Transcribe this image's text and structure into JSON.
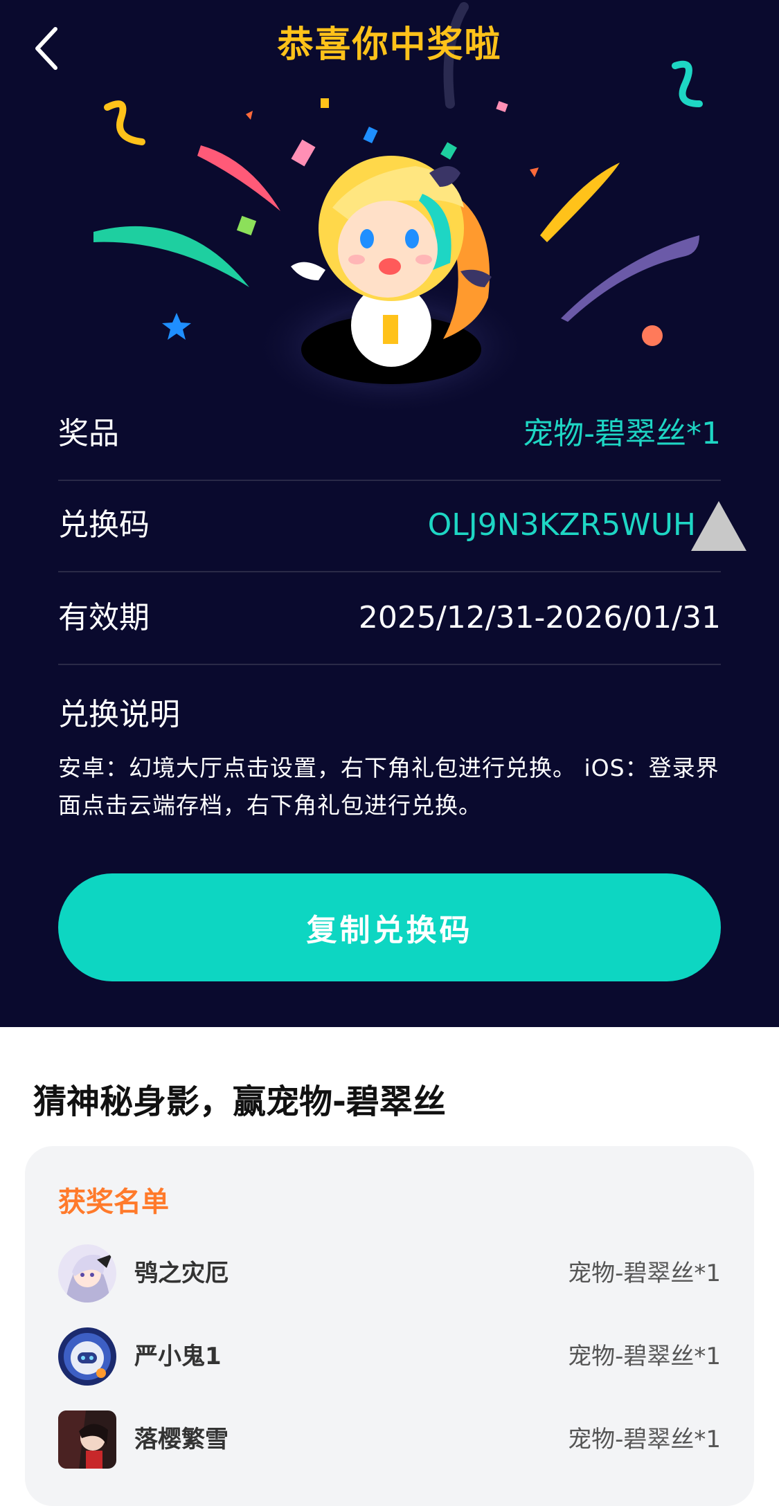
{
  "header": {
    "title": "恭喜你中奖啦"
  },
  "prize_info": {
    "prize_label": "奖品",
    "prize_value": "宠物-碧翠丝*1",
    "code_label": "兑换码",
    "code_value": "OLJ9N3KZR5WUH",
    "validity_label": "有效期",
    "validity_value": "2025/12/31-2026/01/31",
    "instructions_label": "兑换说明",
    "instructions_text": "安卓：幻境大厅点击设置，右下角礼包进行兑换。 iOS：登录界面点击云端存档，右下角礼包进行兑换。"
  },
  "actions": {
    "copy_label": "复制兑换码"
  },
  "event": {
    "title": "猜神秘身影，赢宠物-碧翠丝"
  },
  "winners": {
    "heading": "获奖名单",
    "items": [
      {
        "name": "鸮之灾厄",
        "prize": "宠物-碧翠丝*1"
      },
      {
        "name": "严小鬼1",
        "prize": "宠物-碧翠丝*1"
      },
      {
        "name": "落樱繁雪",
        "prize": "宠物-碧翠丝*1"
      }
    ]
  },
  "colors": {
    "hero_bg": "#0a0a2e",
    "title": "#ffc21a",
    "accent_teal": "#0dd6c2",
    "winners_heading": "#ff7a2b"
  }
}
